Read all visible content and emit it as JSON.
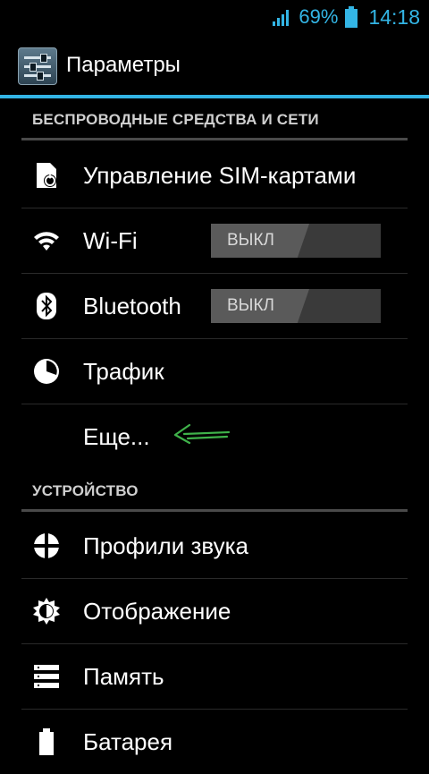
{
  "status_bar": {
    "battery_percent": "69%",
    "time": "14:18"
  },
  "action_bar": {
    "title": "Параметры",
    "icon": "settings-icon"
  },
  "sections": [
    {
      "header": "БЕСПРОВОДНЫЕ СРЕДСТВА И СЕТИ",
      "items": [
        {
          "label": "Управление SIM-картами",
          "icon": "sim-card-icon"
        },
        {
          "label": "Wi-Fi",
          "icon": "wifi-icon",
          "toggle": "ВЫКЛ"
        },
        {
          "label": "Bluetooth",
          "icon": "bluetooth-icon",
          "toggle": "ВЫКЛ"
        },
        {
          "label": "Трафик",
          "icon": "data-usage-icon"
        },
        {
          "label": "Еще..."
        }
      ]
    },
    {
      "header": "УСТРОЙСТВО",
      "items": [
        {
          "label": "Профили звука",
          "icon": "sound-profile-icon"
        },
        {
          "label": "Отображение",
          "icon": "display-icon"
        },
        {
          "label": "Память",
          "icon": "storage-icon"
        },
        {
          "label": "Батарея",
          "icon": "battery-icon"
        }
      ]
    }
  ],
  "colors": {
    "accent": "#33b5e5",
    "annotation_arrow": "#3fb24a"
  }
}
